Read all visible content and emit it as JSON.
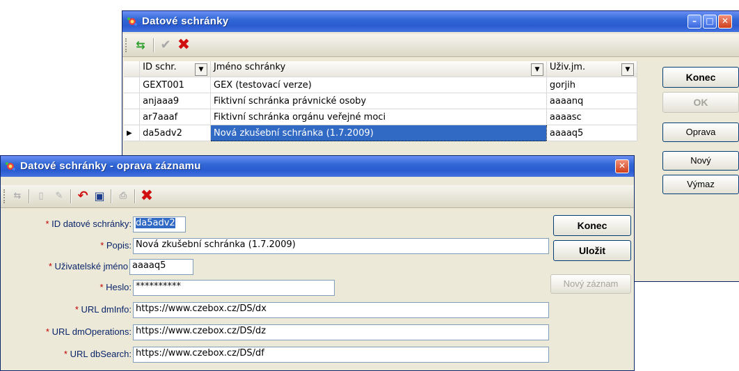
{
  "main_window": {
    "title": "Datové schránky",
    "grid": {
      "headers": [
        "ID schr.",
        "Jméno schránky",
        "Uživ.jm."
      ],
      "rows": [
        {
          "id": "GEXT001",
          "name": "GEX (testovací verze)",
          "user": "gorjih"
        },
        {
          "id": "anjaaa9",
          "name": "Fiktivní schránka právnické osoby",
          "user": "aaaanq"
        },
        {
          "id": "ar7aaaf",
          "name": "Fiktivní schránka orgánu veřejné moci",
          "user": "aaaasc"
        },
        {
          "id": "da5adv2",
          "name": "Nová zkušební schránka (1.7.2009)",
          "user": "aaaaq5"
        }
      ]
    },
    "buttons": {
      "konec": "Konec",
      "ok": "OK",
      "oprava": "Oprava",
      "novy": "Nový",
      "vymaz": "Výmaz"
    }
  },
  "edit_dialog": {
    "title": "Datové schránky - oprava záznamu",
    "labels": {
      "id": "ID datové schránky:",
      "popis": "Popis:",
      "user": "Uživatelské jméno",
      "heslo": "Heslo:",
      "dminfo": "URL dmInfo:",
      "dmops": "URL dmOperations:",
      "dbsearch": "URL dbSearch:"
    },
    "values": {
      "id": "da5adv2",
      "popis": "Nová zkušební schránka (1.7.2009)",
      "user": "aaaaq5",
      "heslo": "**********",
      "dminfo": "https://www.czebox.cz/DS/dx",
      "dmops": "https://www.czebox.cz/DS/dz",
      "dbsearch": "https://www.czebox.cz/DS/df"
    },
    "buttons": {
      "konec": "Konec",
      "ulozit": "Uložit",
      "novy_zaznam": "Nový záznam"
    }
  },
  "colors": {
    "title_bar": "#3168d5",
    "selection": "#316ac5",
    "required_star": "#c00000"
  }
}
